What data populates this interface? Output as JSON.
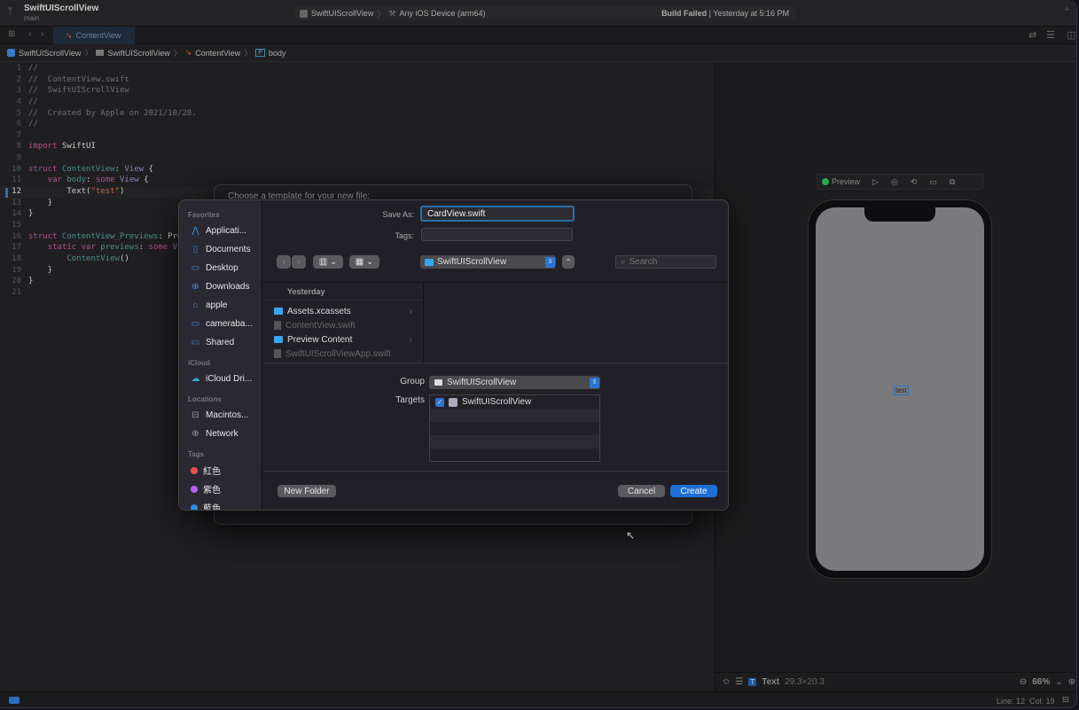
{
  "window": {
    "project": "SwiftUIScrollView",
    "branch": "main",
    "scheme": "SwiftUIScrollView",
    "destination": "Any iOS Device (arm64)",
    "build_status": "Build Failed",
    "build_time": "Yesterday at 5:16 PM"
  },
  "tab": {
    "label": "ContentView"
  },
  "breadcrumb": [
    "SwiftUIScrollView",
    "SwiftUIScrollView",
    "ContentView",
    "body"
  ],
  "editor": {
    "line_numbers": [
      "1",
      "2",
      "3",
      "4",
      "5",
      "6",
      "7",
      "8",
      "9",
      "10",
      "11",
      "12",
      "13",
      "14",
      "15",
      "16",
      "17",
      "18",
      "19",
      "20",
      "21"
    ],
    "current_line": "12"
  },
  "status": {
    "line": "Line: 12",
    "col": "Col: 19"
  },
  "canvas": {
    "preview_label": "Preview",
    "selected_type": "Text",
    "selected_size": "29.3×20.3",
    "zoom": "66%",
    "preview_text": "test"
  },
  "back_dialog": {
    "title": "Choose a template for your new file:"
  },
  "dialog": {
    "save_as_label": "Save As:",
    "save_as_value": "CardView.swift",
    "tags_label": "Tags:",
    "location": "SwiftUIScrollView",
    "search_placeholder": "Search",
    "sidebar": {
      "favorites_header": "Favorites",
      "favorites": [
        {
          "label": "Applicati...",
          "icon": "applications-icon"
        },
        {
          "label": "Documents",
          "icon": "document-icon"
        },
        {
          "label": "Desktop",
          "icon": "desktop-icon"
        },
        {
          "label": "Downloads",
          "icon": "downloads-icon"
        },
        {
          "label": "apple",
          "icon": "home-icon"
        },
        {
          "label": "cameraba...",
          "icon": "folder-icon"
        },
        {
          "label": "Shared",
          "icon": "folder-icon"
        }
      ],
      "icloud_header": "iCloud",
      "icloud": [
        {
          "label": "iCloud Dri...",
          "icon": "cloud-icon"
        }
      ],
      "locations_header": "Locations",
      "locations": [
        {
          "label": "Macintos...",
          "icon": "disk-icon"
        },
        {
          "label": "Network",
          "icon": "network-icon"
        }
      ],
      "tags_header": "Tags",
      "tags": [
        {
          "label": "紅色",
          "color": "#f0524a"
        },
        {
          "label": "紫色",
          "color": "#bf5af2"
        },
        {
          "label": "藍色",
          "color": "#2d8cf0"
        }
      ]
    },
    "files_header": "Yesterday",
    "files": [
      {
        "name": "Assets.xcassets",
        "type": "folder",
        "enabled": true
      },
      {
        "name": "ContentView.swift",
        "type": "file",
        "enabled": false
      },
      {
        "name": "Preview Content",
        "type": "folder",
        "enabled": true
      },
      {
        "name": "SwiftUIScrollViewApp.swift",
        "type": "file",
        "enabled": false
      }
    ],
    "group_label": "Group",
    "group_value": "SwiftUIScrollView",
    "targets_label": "Targets",
    "targets": [
      {
        "name": "SwiftUIScrollView",
        "checked": true
      }
    ],
    "new_folder": "New Folder",
    "cancel": "Cancel",
    "create": "Create"
  }
}
